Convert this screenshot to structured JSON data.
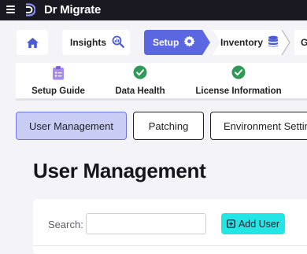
{
  "app": {
    "brand": "Dr Migrate",
    "colors": {
      "topbar": "#1a1820",
      "accent": "#5b67e0",
      "success": "#2f9a57",
      "cta": "#22e6e6"
    }
  },
  "breadcrumbs": {
    "home_icon": "home-icon",
    "items": [
      {
        "label": "Insights",
        "icon": "analytics-search-icon",
        "active": false
      },
      {
        "label": "Setup",
        "icon": "gear-icon",
        "active": true
      },
      {
        "label": "Inventory",
        "icon": "database-icon",
        "active": false
      },
      {
        "label": "G",
        "active": false
      }
    ]
  },
  "steps": [
    {
      "label": "Setup Guide",
      "icon": "clipboard-icon"
    },
    {
      "label": "Data Health",
      "icon": "check-circle-icon"
    },
    {
      "label": "License Information",
      "icon": "check-circle-icon"
    }
  ],
  "tabs": [
    {
      "label": "User Management",
      "selected": true
    },
    {
      "label": "Patching",
      "selected": false
    },
    {
      "label": "Environment Settings",
      "selected": false
    }
  ],
  "page": {
    "title": "User Management",
    "search_label": "Search:",
    "search_value": "",
    "search_placeholder": "",
    "add_button_label": "Add User"
  }
}
